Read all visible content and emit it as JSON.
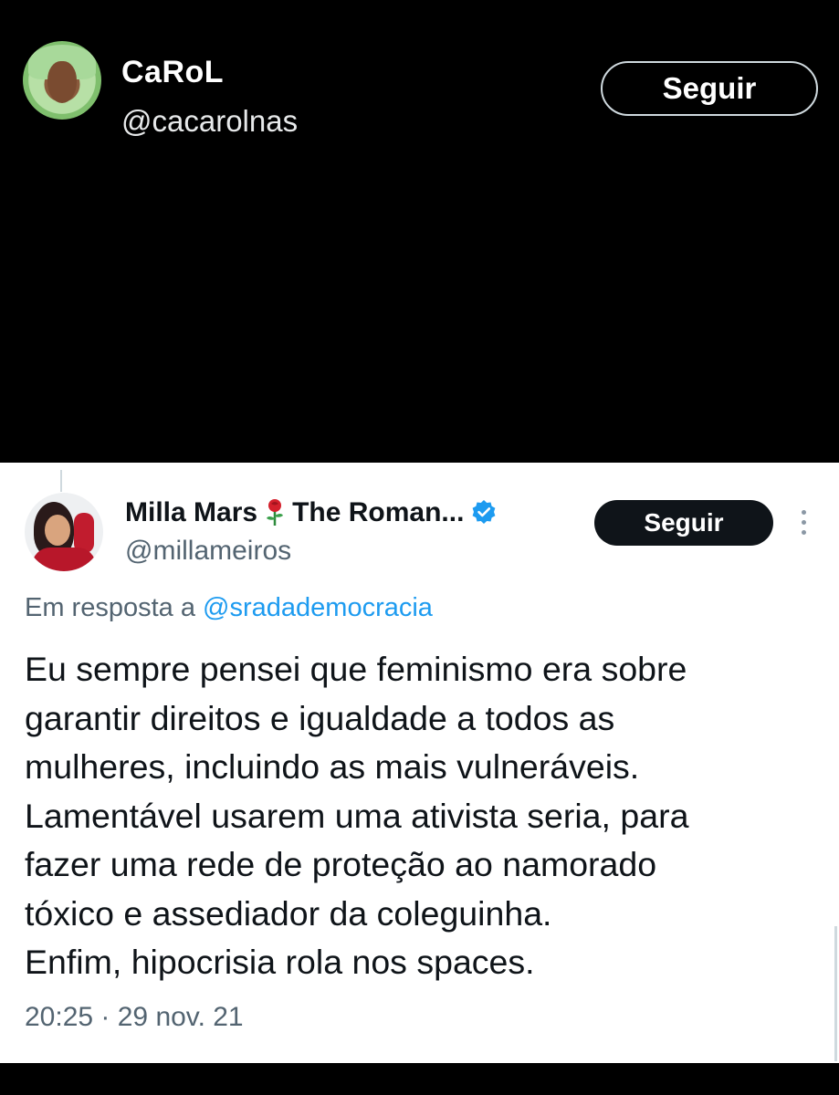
{
  "top_tweet": {
    "name": "CaRoL",
    "handle": "@cacarolnas",
    "follow_label": "Seguir"
  },
  "quoted_tweet": {
    "name_part1": "Milla Mars",
    "name_emoji": "rose",
    "name_part2": "The Roman...",
    "handle": "@millameiros",
    "follow_label": "Seguir",
    "reply_prefix": "Em resposta a",
    "reply_mention": "@sradademocracia",
    "text_lines": [
      "Eu sempre pensei que feminismo era sobre",
      "garantir direitos e igualdade a todos as",
      "mulheres, incluindo as mais vulneráveis.",
      "Lamentável usarem uma ativista seria, para",
      "fazer uma rede de proteção ao namorado",
      "tóxico e assediador da coleguinha.",
      "Enfim, hipocrisia rola nos spaces."
    ],
    "timestamp": "20:25 · 29 nov. 21"
  },
  "colors": {
    "accent_link": "#1d9bf0",
    "verified": "#1d9bf0",
    "dark_bg": "#000000",
    "light_bg": "#ffffff"
  }
}
